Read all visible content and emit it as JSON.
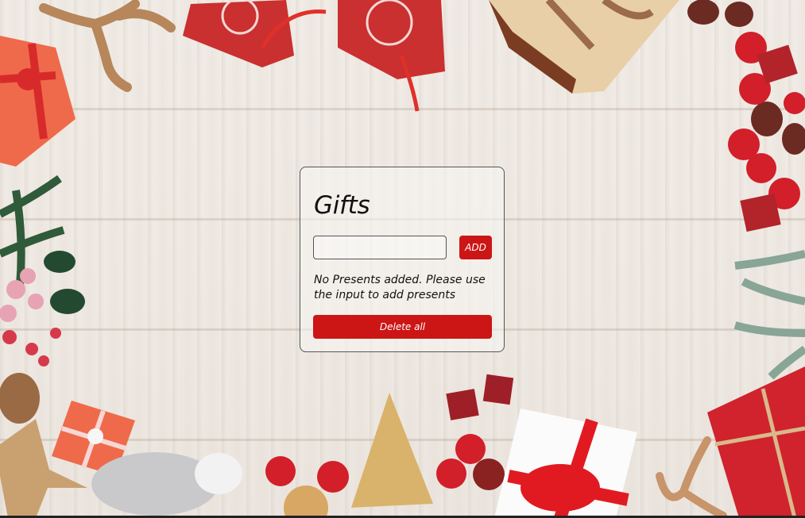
{
  "card": {
    "title": "Gifts",
    "input_value": "",
    "add_label": "ADD",
    "empty_message": "No Presents added. Please use the input to add presents",
    "delete_all_label": "Delete all"
  },
  "colors": {
    "accent": "#cc1515",
    "background": "#efeae4",
    "text": "#111111"
  },
  "decor_icons": [
    "reindeer-figurine",
    "red-snowflake-gift-box",
    "kraft-gift-box",
    "pine-cone",
    "red-bauble",
    "fir-branch",
    "gold-tree-ornament",
    "gold-star",
    "tinsel"
  ]
}
